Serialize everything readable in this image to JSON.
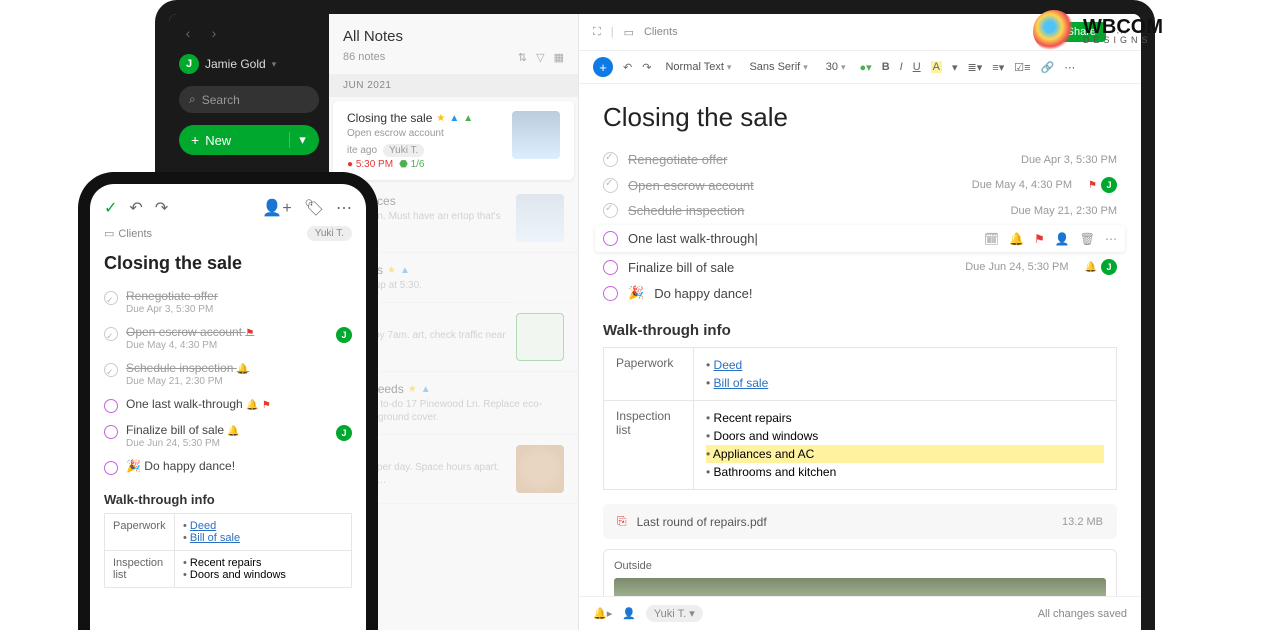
{
  "watermark": {
    "brand": "WBCOM",
    "sub": "DESIGNS"
  },
  "sidebar": {
    "user_initial": "J",
    "user_name": "Jamie Gold",
    "search_label": "Search",
    "new_label": "New"
  },
  "notelist": {
    "header": "All Notes",
    "count_label": "86 notes",
    "section": "JUN 2021",
    "items": [
      {
        "title": "Closing the sale",
        "desc": "Open escrow account",
        "meta_time": "ite ago",
        "author": "Yuki T.",
        "pill": "1/6"
      },
      {
        "title": "eferences",
        "desc": "e kitchen. Must have an ertop that's well …"
      },
      {
        "title": "ograms",
        "desc": "… Pickup at 5:30."
      },
      {
        "title": "etails",
        "desc": "airport by 7am. art, check traffic near …"
      },
      {
        "title": "ning Needs",
        "desc": "scaping to-do 17 Pinewood Ln. Replace eco-friendly ground cover."
      },
      {
        "title": "ting",
        "desc": "d twice per day. Space hours apart. Please …"
      }
    ]
  },
  "editor": {
    "notebook_label": "Clients",
    "share_label": "Share",
    "format_style": "Normal Text",
    "font_family": "Sans Serif",
    "font_size": "30",
    "title": "Closing the sale",
    "tasks": [
      {
        "done": true,
        "title": "Renegotiate offer",
        "due": "Due Apr 3, 5:30 PM"
      },
      {
        "done": true,
        "title": "Open escrow account",
        "due": "Due May 4, 4:30 PM",
        "flag": true,
        "avatar": "J"
      },
      {
        "done": true,
        "title": "Schedule inspection",
        "due": "Due May 21, 2:30 PM"
      },
      {
        "done": false,
        "editing": true,
        "title": "One last walk-through"
      },
      {
        "done": false,
        "title": "Finalize bill of sale",
        "due": "Due Jun 24, 5:30 PM",
        "bell": true,
        "avatar": "J"
      },
      {
        "done": false,
        "emoji": "🎉",
        "title": "Do happy dance!"
      }
    ],
    "section_header": "Walk-through info",
    "table": {
      "row1_label": "Paperwork",
      "row1_links": [
        "Deed",
        "Bill of sale"
      ],
      "row2_label": "Inspection list",
      "row2_items": [
        "Recent repairs",
        "Doors and windows",
        "Appliances and AC",
        "Bathrooms and kitchen"
      ],
      "row2_highlight_idx": 2
    },
    "attachment": {
      "name": "Last round of repairs.pdf",
      "size": "13.2 MB"
    },
    "photo_caption": "Outside",
    "footer_author": "Yuki T.",
    "footer_saved": "All changes saved"
  },
  "phone": {
    "notebook_label": "Clients",
    "author_pill": "Yuki T.",
    "title": "Closing the sale",
    "tasks": [
      {
        "done": true,
        "title": "Renegotiate offer",
        "due": "Due Apr 3, 5:30 PM"
      },
      {
        "done": true,
        "title": "Open escrow account",
        "due": "Due May 4, 4:30 PM",
        "flag": true,
        "avatar": "J"
      },
      {
        "done": true,
        "title": "Schedule inspection",
        "due": "Due May 21, 2:30 PM",
        "bell": true
      },
      {
        "done": false,
        "title": "One last walk-through",
        "bell": true,
        "flag": true
      },
      {
        "done": false,
        "title": "Finalize bill of sale",
        "due": "Due Jun 24, 5:30 PM",
        "bell": true,
        "avatar": "J"
      },
      {
        "done": false,
        "emoji": "🎉",
        "title": "Do happy dance!"
      }
    ],
    "section_header": "Walk-through info",
    "table": {
      "row1_label": "Paperwork",
      "row1_links": [
        "Deed",
        "Bill of sale"
      ],
      "row2_label": "Inspection list",
      "row2_items": [
        "Recent repairs",
        "Doors and windows"
      ]
    }
  }
}
